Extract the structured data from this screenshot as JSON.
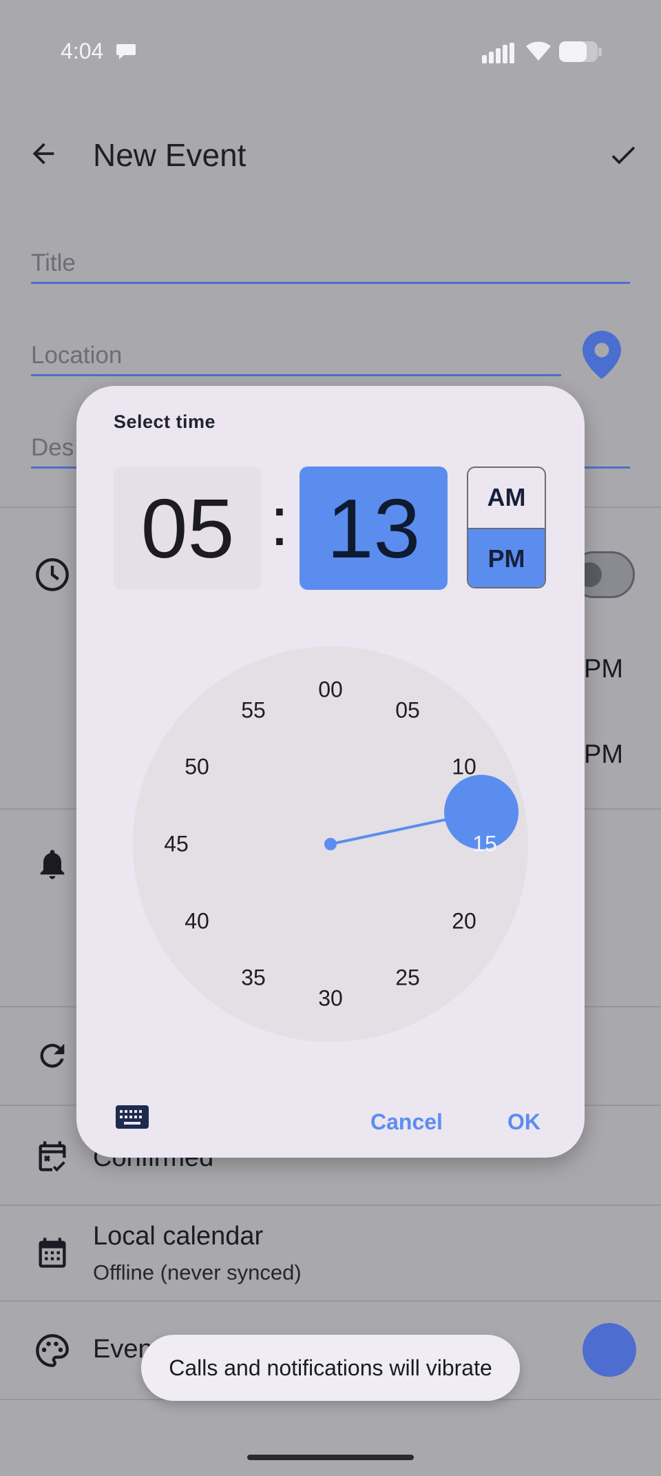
{
  "status_bar": {
    "time": "4:04"
  },
  "app_bar": {
    "title": "New Event"
  },
  "form": {
    "title_placeholder": "Title",
    "location_placeholder": "Location",
    "description_placeholder": "Description",
    "description_visible": "Des"
  },
  "background_rows": {
    "start_time_suffix": "PM",
    "end_time_suffix": "PM",
    "status_visible": "Confirmed",
    "calendar_name": "Local calendar",
    "calendar_sub": "Offline (never synced)",
    "event_color_visible": "Even"
  },
  "time_picker": {
    "heading": "Select time",
    "hour": "05",
    "separator": ":",
    "minute": "13",
    "am_label": "AM",
    "pm_label": "PM",
    "selected_period": "PM",
    "minute_labels": [
      "00",
      "05",
      "10",
      "15",
      "20",
      "25",
      "30",
      "35",
      "40",
      "45",
      "50",
      "55"
    ],
    "selected_minute_value": 13,
    "cancel_label": "Cancel",
    "ok_label": "OK"
  },
  "snackbar": {
    "message": "Calls and notifications will vibrate"
  },
  "colors": {
    "accent": "#5b8def",
    "scrim": "#a9a8ac",
    "dialog": "#ebe6f0"
  },
  "icons": [
    "chat-bubble-icon",
    "cell-signal-icon",
    "wifi-icon",
    "battery-icon",
    "back-arrow-icon",
    "checkmark-icon",
    "location-pin-icon",
    "clock-icon",
    "bell-icon",
    "repeat-icon",
    "calendar-check-icon",
    "calendar-icon",
    "palette-icon",
    "keyboard-icon"
  ]
}
